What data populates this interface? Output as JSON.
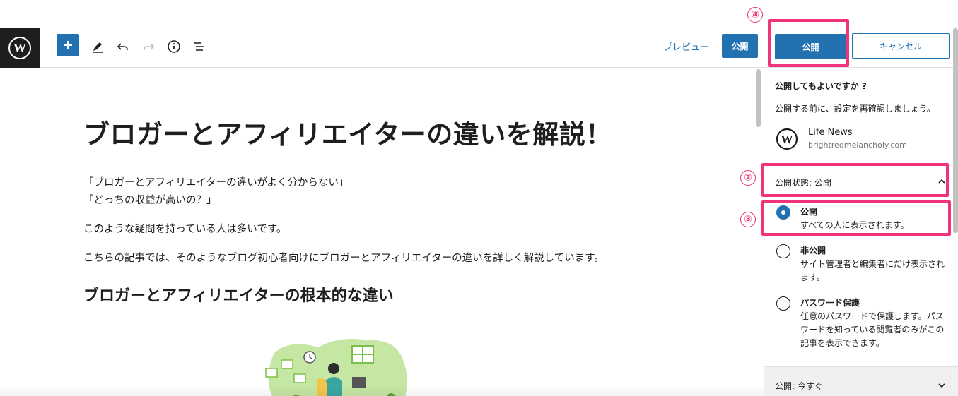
{
  "toolbar": {
    "logo_icon": "wordpress-logo-icon",
    "icons": [
      "plus-icon",
      "pencil-icon",
      "undo-icon",
      "redo-icon",
      "info-icon",
      "list-view-icon"
    ],
    "preview_label": "プレビュー",
    "publish_label": "公開"
  },
  "post": {
    "title": "ブロガーとアフィリエイターの違いを解説！",
    "paragraph1_line1": "「ブロガーとアフィリエイターの違いがよく分からない」",
    "paragraph1_line2": "「どっちの収益が高いの？」",
    "paragraph2": "このような疑問を持っている人は多いです。",
    "paragraph3": "こちらの記事では、そのようなブログ初心者向けにブロガーとアフィリエイターの違いを詳しく解説しています。",
    "heading2": "ブロガーとアフィリエイターの根本的な違い"
  },
  "publish_panel": {
    "publish_button": "公開",
    "cancel_button": "キャンセル",
    "question": "公開してもよいですか ?",
    "hint": "公開する前に、設定を再確認しましょう。",
    "site_name": "Life News",
    "site_url": "brightredmelancholy.com",
    "status_label": "公開状態: 公開",
    "options": [
      {
        "title": "公開",
        "desc": "すべての人に表示されます。",
        "checked": true
      },
      {
        "title": "非公開",
        "desc": "サイト管理者と編集者にだけ表示されます。",
        "checked": false
      },
      {
        "title": "パスワード保護",
        "desc": "任意のパスワードで保護します。パスワードを知っている閲覧者のみがこの記事を表示できます。",
        "checked": false
      }
    ],
    "schedule_label": "公開: 今すぐ"
  },
  "annotations": {
    "num2": "②",
    "num3": "③",
    "num4": "④",
    "color": "#f0347a"
  },
  "colors": {
    "accent": "#2271b1",
    "dark": "#1e1e1e"
  }
}
